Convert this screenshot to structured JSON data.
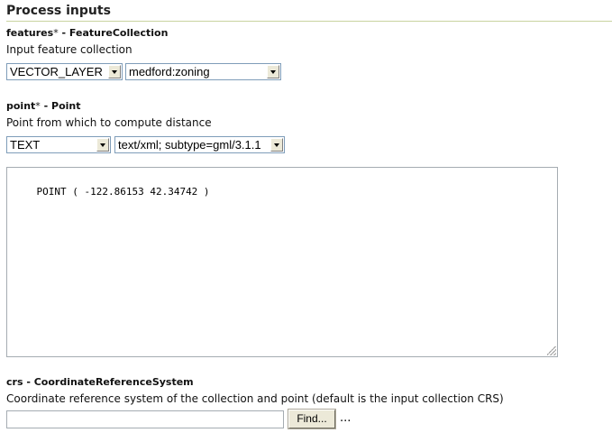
{
  "section_title": "Process inputs",
  "params": [
    {
      "name": "features",
      "required_mark": "*",
      "type_text": " - FeatureCollection",
      "description": "Input feature collection",
      "selects": [
        {
          "selected": "VECTOR_LAYER"
        },
        {
          "selected": "medford:zoning"
        }
      ]
    },
    {
      "name": "point",
      "required_mark": "*",
      "type_text": " - Point",
      "description": "Point from which to compute distance",
      "selects": [
        {
          "selected": "TEXT"
        },
        {
          "selected": "text/xml; subtype=gml/3.1.1"
        }
      ],
      "textarea_value": "POINT ( -122.86153 42.34742 )"
    },
    {
      "name": "crs",
      "required_mark": "",
      "type_text": " - CoordinateReferenceSystem",
      "description": "Coordinate reference system of the collection and point (default is the input collection CRS)",
      "input_value": "",
      "button_label": "Find...",
      "ellipsis": "..."
    }
  ],
  "icons": {
    "dropdown": "chevron-down-icon",
    "resize": "resize-grip-icon"
  },
  "colors": {
    "title_rule": "#c9d3a0",
    "control_border": "#7f9db9",
    "button_face": "#ece9d8"
  }
}
